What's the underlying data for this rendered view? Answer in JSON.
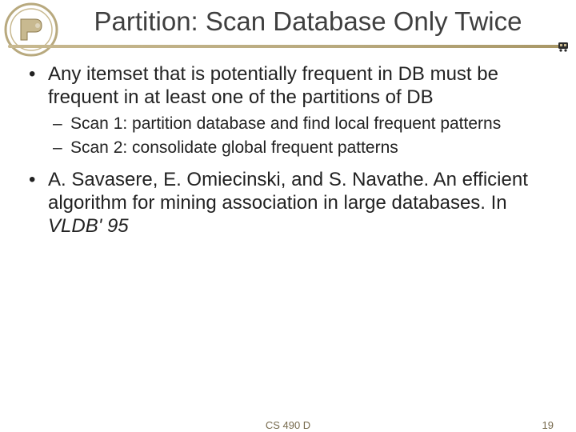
{
  "title": "Partition: Scan Database Only Twice",
  "bullets": {
    "b1": "Any itemset that is potentially frequent in DB must be frequent in at least one of the partitions of DB",
    "sub1": "Scan 1: partition database and find local frequent patterns",
    "sub2": "Scan 2: consolidate global frequent patterns",
    "b2_prefix": "A. Savasere, E. Omiecinski, and S. Navathe. An efficient algorithm for mining association in large databases. In ",
    "b2_italic": "VLDB' 95"
  },
  "footer": {
    "center": "CS 490 D",
    "right": "19"
  },
  "colors": {
    "logo_fill": "#c8b990",
    "logo_stroke": "#8d7a4e"
  }
}
